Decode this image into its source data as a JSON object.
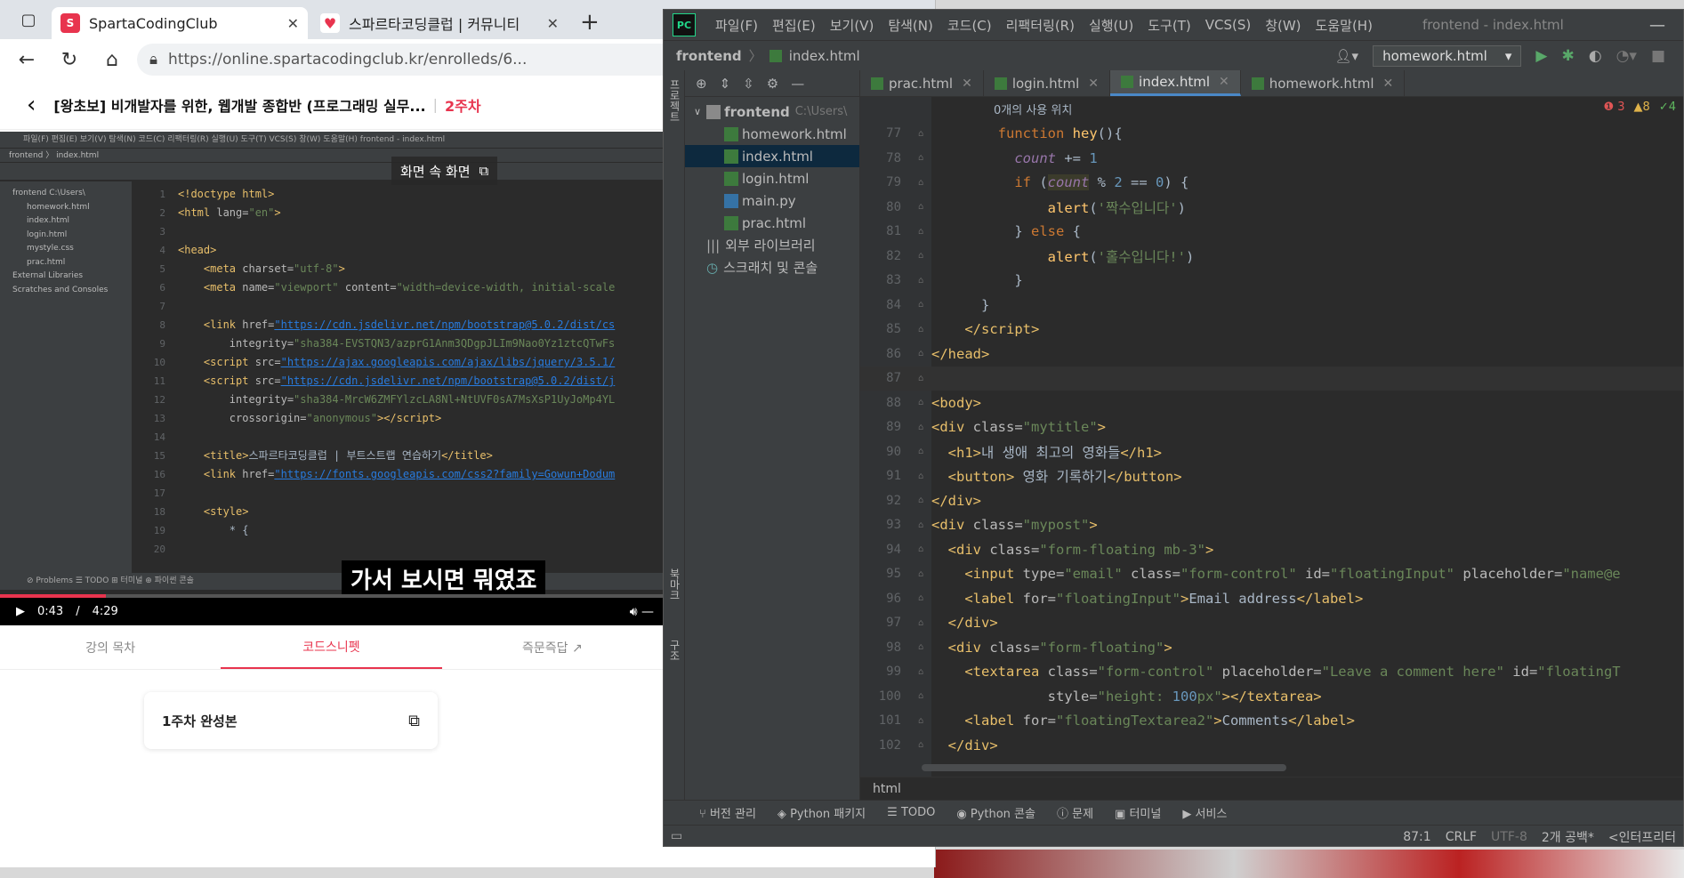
{
  "browser": {
    "tabs": [
      {
        "title": "SpartaCodingClub",
        "close": "✕",
        "fav_color": "#e8344e",
        "fav": "S"
      },
      {
        "title": "스파르타코딩클럽 | 커뮤니티",
        "close": "✕",
        "fav_color": "#e8344e",
        "fav": "♥"
      }
    ],
    "new_tab": "+",
    "url": "https://online.spartacodingclub.kr/enrolleds/6...",
    "course_title": "[왕초보] 비개발자를 위한, 웹개발 종합반 (프로그래밍 실무...",
    "week": "2주차"
  },
  "video": {
    "pip_label": "화면 속 화면",
    "subtitle": "가서 보시면 뭐였죠",
    "time_current": "0:43",
    "time_separator": "/",
    "time_total": "4:29",
    "progress": 0.16,
    "mini_menu": "파일(F)  편집(E)  보기(V)  탐색(N)  코드(C)  리팩터링(R)  실행(U)  도구(T)  VCS(S)  창(W)  도움말(H)       frontend - index.html",
    "mini_path": "frontend 〉 index.html",
    "mini_tree": [
      "frontend C:\\Users\\",
      "homework.html",
      "index.html",
      "login.html",
      "mystyle.css",
      "prac.html",
      "External Libraries",
      "Scratches and Consoles"
    ],
    "mini_status": "⊘ Problems   ☰ TODO   ⊞ 터미널   ⊕ 파이썬 콘솔",
    "mini_lines": [
      {
        "n": "1",
        "html": "&lt;!doctype html&gt;"
      },
      {
        "n": "2",
        "html": "&lt;html <span class='a'>lang=</span><span class='s'>\"en\"</span>&gt;"
      },
      {
        "n": "3",
        "html": ""
      },
      {
        "n": "4",
        "html": "&lt;head&gt;"
      },
      {
        "n": "5",
        "html": "    &lt;meta <span class='a'>charset=</span><span class='s'>\"utf-8\"</span>&gt;"
      },
      {
        "n": "6",
        "html": "    &lt;meta <span class='a'>name=</span><span class='s'>\"viewport\"</span> <span class='a'>content=</span><span class='s'>\"width=device-width, initial-scale</span>"
      },
      {
        "n": "7",
        "html": ""
      },
      {
        "n": "8",
        "html": "    &lt;link <span class='a'>href=</span><span class='u'>\"https://cdn.jsdelivr.net/npm/bootstrap@5.0.2/dist/cs</span>"
      },
      {
        "n": "9",
        "html": "        <span class='a'>integrity=</span><span class='s'>\"sha384-EVSTQN3/azprG1Anm3QDgpJLIm9Nao0Yz1ztcQTwFs</span>"
      },
      {
        "n": "10",
        "html": "    &lt;script <span class='a'>src=</span><span class='u'>\"https://ajax.googleapis.com/ajax/libs/jquery/3.5.1/</span>"
      },
      {
        "n": "11",
        "html": "    &lt;script <span class='a'>src=</span><span class='u'>\"https://cdn.jsdelivr.net/npm/bootstrap@5.0.2/dist/j</span>"
      },
      {
        "n": "12",
        "html": "        <span class='a'>integrity=</span><span class='s'>\"sha384-MrcW6ZMFYlzcLA8Nl+NtUVF0sA7MsXsP1UyJoMp4YL</span>"
      },
      {
        "n": "13",
        "html": "        <span class='a'>crossorigin=</span><span class='s'>\"anonymous\"</span>&gt;&lt;/script&gt;"
      },
      {
        "n": "14",
        "html": ""
      },
      {
        "n": "15",
        "html": "    &lt;title&gt;<span class='t'>스파르타코딩클럽 | 부트스트랩 연습하기</span>&lt;/title&gt;"
      },
      {
        "n": "16",
        "html": "    &lt;link <span class='a'>href=</span><span class='u'>\"https://fonts.googleapis.com/css2?family=Gowun+Dodum</span>"
      },
      {
        "n": "17",
        "html": ""
      },
      {
        "n": "18",
        "html": "    &lt;style&gt;"
      },
      {
        "n": "19",
        "html": "        <span class='t'>* {</span>"
      },
      {
        "n": "20",
        "html": ""
      }
    ]
  },
  "lecture_tabs": [
    {
      "label": "강의 목차",
      "active": false
    },
    {
      "label": "코드스니펫",
      "active": true
    },
    {
      "label": "즉문즉답 ↗",
      "active": false
    }
  ],
  "snippet": {
    "label": "1주차 완성본",
    "copy_icon": "⧉"
  },
  "ide": {
    "logo": "PC",
    "menu": [
      "파일(F)",
      "편집(E)",
      "보기(V)",
      "탐색(N)",
      "코드(C)",
      "리팩터링(R)",
      "실행(U)",
      "도구(T)",
      "VCS(S)",
      "창(W)",
      "도움말(H)"
    ],
    "window_title": "frontend - index.html",
    "minimize": "—",
    "breadcrumb": [
      "frontend",
      "index.html"
    ],
    "run_config": "homework.html",
    "project_root": "frontend",
    "project_root_path": "C:\\Users\\",
    "files": [
      {
        "name": "homework.html",
        "type": "html",
        "selected": false
      },
      {
        "name": "index.html",
        "type": "html",
        "selected": true
      },
      {
        "name": "login.html",
        "type": "html",
        "selected": false
      },
      {
        "name": "main.py",
        "type": "py",
        "selected": false
      },
      {
        "name": "prac.html",
        "type": "html",
        "selected": false
      }
    ],
    "external_libs": "외부 라이브러리",
    "scratches": "스크래치 및 콘솔",
    "editor_tabs": [
      {
        "name": "prac.html",
        "active": false
      },
      {
        "name": "login.html",
        "active": false
      },
      {
        "name": "index.html",
        "active": true
      },
      {
        "name": "homework.html",
        "active": false
      }
    ],
    "inspections": {
      "errors": "3",
      "warnings": "8",
      "ok": "4"
    },
    "usage_hint": "0개의 사용 위치",
    "code_lines": [
      {
        "n": "77",
        "html": "        <span class='k'>function</span> <span class='fn'>hey</span>(){"
      },
      {
        "n": "78",
        "html": "          <span class='pv'>count</span> += <span class='nm'>1</span>"
      },
      {
        "n": "79",
        "html": "          <span class='k'>if</span> (<span class='pv hl'>count</span> % <span class='nm'>2</span> == <span class='nm'>0</span>) {"
      },
      {
        "n": "80",
        "html": "              <span class='fn'>alert</span>(<span class='st'>'짝수입니다'</span>)"
      },
      {
        "n": "81",
        "html": "          } <span class='k'>else</span> {"
      },
      {
        "n": "82",
        "html": "              <span class='fn'>alert</span>(<span class='st'>'홀수입니다!'</span>)"
      },
      {
        "n": "83",
        "html": "          }"
      },
      {
        "n": "84",
        "html": "      }"
      },
      {
        "n": "85",
        "html": "    <span class='tg'>&lt;/script&gt;</span>"
      },
      {
        "n": "86",
        "html": "<span class='tg'>&lt;/head&gt;</span>"
      },
      {
        "n": "87",
        "html": "",
        "cur": true
      },
      {
        "n": "88",
        "html": "<span class='tg'>&lt;body&gt;</span>"
      },
      {
        "n": "89",
        "html": "<span class='tg'>&lt;div </span><span class='at'>class=</span><span class='st'>\"mytitle\"</span><span class='tg'>&gt;</span>"
      },
      {
        "n": "90",
        "html": "  <span class='tg'>&lt;h1&gt;</span>내 생애 최고의 영화들<span class='tg'>&lt;/h1&gt;</span>"
      },
      {
        "n": "91",
        "html": "  <span class='tg'>&lt;button&gt;</span> 영화 기록하기<span class='tg'>&lt;/button&gt;</span>"
      },
      {
        "n": "92",
        "html": "<span class='tg'>&lt;/div&gt;</span>"
      },
      {
        "n": "93",
        "html": "<span class='tg'>&lt;div </span><span class='at'>class=</span><span class='st'>\"mypost\"</span><span class='tg'>&gt;</span>"
      },
      {
        "n": "94",
        "html": "  <span class='tg'>&lt;div </span><span class='at'>class=</span><span class='st'>\"form-floating mb-3\"</span><span class='tg'>&gt;</span>"
      },
      {
        "n": "95",
        "html": "    <span class='tg'>&lt;input </span><span class='at'>type=</span><span class='st'>\"email\"</span> <span class='at'>class=</span><span class='st'>\"form-control\"</span> <span class='at'>id=</span><span class='st'>\"floatingInput\"</span> <span class='at'>placeholder=</span><span class='st'>\"name@e</span>"
      },
      {
        "n": "96",
        "html": "    <span class='tg'>&lt;label </span><span class='at'>for=</span><span class='st'>\"floatingInput\"</span><span class='tg'>&gt;</span>Email address<span class='tg'>&lt;/label&gt;</span>"
      },
      {
        "n": "97",
        "html": "  <span class='tg'>&lt;/div&gt;</span>"
      },
      {
        "n": "98",
        "html": "  <span class='tg'>&lt;div </span><span class='at'>class=</span><span class='st'>\"form-floating\"</span><span class='tg'>&gt;</span>"
      },
      {
        "n": "99",
        "html": "    <span class='tg'>&lt;textarea </span><span class='at'>class=</span><span class='st'>\"form-control\"</span> <span class='at'>placeholder=</span><span class='st'>\"Leave a comment here\"</span> <span class='at'>id=</span><span class='st'>\"floatingT</span>"
      },
      {
        "n": "100",
        "html": "              <span class='at'>style=</span><span class='st'>\"height: </span><span class='nm'>100</span><span class='st'>px\"</span><span class='tg'>&gt;&lt;/textarea&gt;</span>"
      },
      {
        "n": "101",
        "html": "    <span class='tg'>&lt;label </span><span class='at'>for=</span><span class='st'>\"floatingTextarea2\"</span><span class='tg'>&gt;</span>Comments<span class='tg'>&lt;/label&gt;</span>"
      },
      {
        "n": "102",
        "html": "  <span class='tg'>&lt;/div&gt;</span>"
      }
    ],
    "editor_breadcrumb": "html",
    "tool_windows": [
      "버전 관리",
      "Python 패키지",
      "TODO",
      "Python 콘솔",
      "문제",
      "터미널",
      "서비스"
    ],
    "status": {
      "position": "87:1",
      "line_sep": "CRLF",
      "encoding": "UTF-8",
      "indent": "2개 공백*",
      "interpreter": "<인터프리터"
    },
    "left_strip_labels": [
      "프로젝트",
      "북마크",
      "구조"
    ]
  }
}
